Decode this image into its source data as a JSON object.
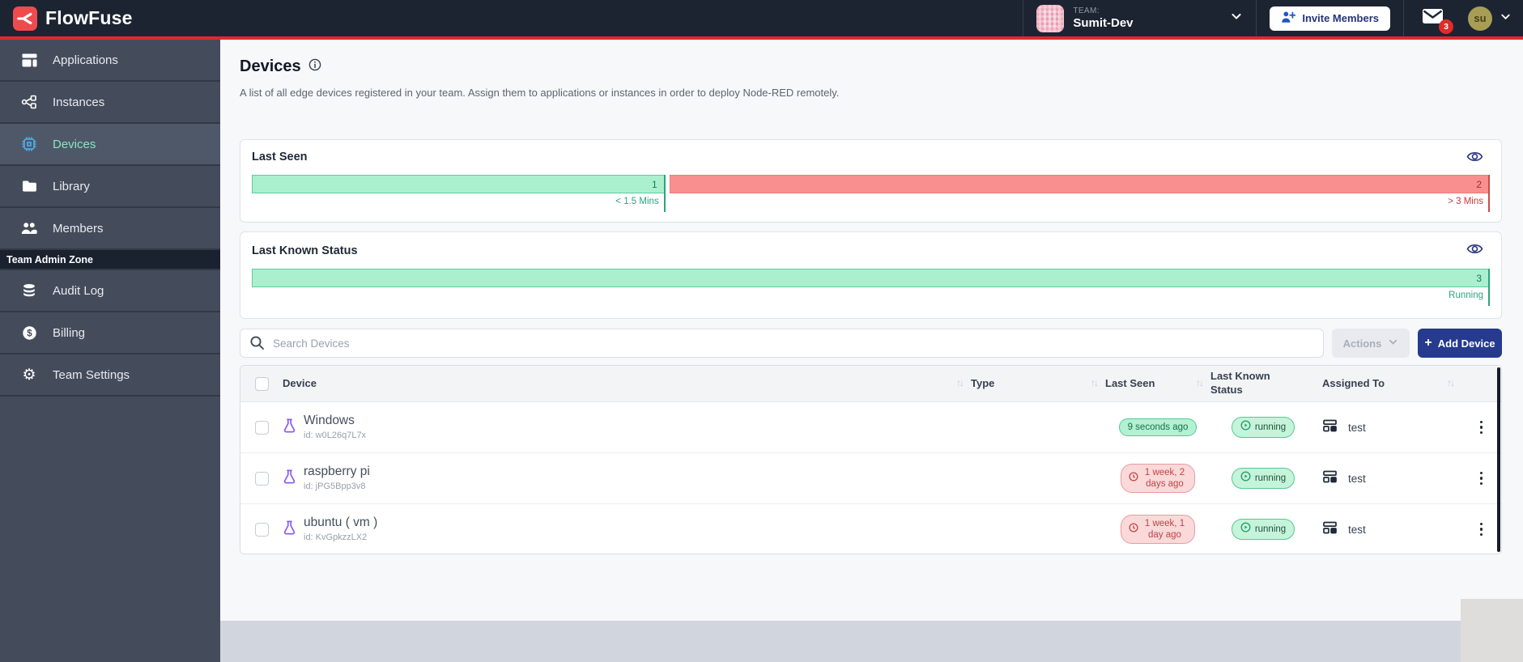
{
  "colors": {
    "accent_red": "#dc2a2e",
    "brand_navy": "#263a8e",
    "status_green_bar": "#aaf0cf",
    "status_red_bar": "#f98f8f",
    "header_bg": "#1c2432",
    "sidebar_bg": "#444c5c"
  },
  "icons": {
    "sort_glyph": "↑↓",
    "gear_glyph": "⚙",
    "plus_glyph": "+"
  },
  "header": {
    "logo_text": "FlowFuse",
    "team_label": "TEAM:",
    "team_name": "Sumit-Dev",
    "invite_members_label": "Invite Members",
    "notification_count": "3",
    "avatar_initials": "su"
  },
  "sidebar": {
    "items": [
      {
        "label": "Applications",
        "icon": "applications-icon"
      },
      {
        "label": "Instances",
        "icon": "instances-icon"
      },
      {
        "label": "Devices",
        "icon": "devices-icon",
        "active": true
      },
      {
        "label": "Library",
        "icon": "library-icon"
      },
      {
        "label": "Members",
        "icon": "members-icon"
      }
    ],
    "admin_zone_label": "Team Admin Zone",
    "admin_items": [
      {
        "label": "Audit Log",
        "icon": "database-icon"
      },
      {
        "label": "Billing",
        "icon": "dollar-icon"
      },
      {
        "label": "Team Settings",
        "icon": "gear-icon"
      }
    ]
  },
  "page": {
    "title": "Devices",
    "description": "A list of all edge devices registered in your team. Assign them to applications or instances in order to deploy Node-RED remotely."
  },
  "charts": {
    "last_seen": {
      "title": "Last Seen",
      "segments": [
        {
          "count": 1,
          "label": "< 1.5 Mins",
          "color": "green"
        },
        {
          "count": 2,
          "label": "> 3 Mins",
          "color": "red"
        }
      ]
    },
    "last_known_status": {
      "title": "Last Known Status",
      "segments": [
        {
          "count": 3,
          "label": "Running",
          "color": "green"
        }
      ]
    }
  },
  "toolbar": {
    "search_placeholder": "Search Devices",
    "actions_label": "Actions",
    "add_device_label": "Add Device"
  },
  "table": {
    "headers": {
      "device": "Device",
      "type": "Type",
      "last_seen": "Last Seen",
      "last_known_status": "Last Known Status",
      "assigned_to": "Assigned To"
    },
    "rows": [
      {
        "name": "Windows",
        "device_id": "id: w0L26q7L7x",
        "last_seen": "9 seconds ago",
        "last_seen_state": "recent",
        "status": "running",
        "assigned_to": "test"
      },
      {
        "name": "raspberry pi",
        "device_id": "id: jPG5Bpp3v8",
        "last_seen": "1 week, 2 days ago",
        "last_seen_state": "stale",
        "status": "running",
        "assigned_to": "test"
      },
      {
        "name": "ubuntu ( vm )",
        "device_id": "id: KvGpkzzLX2",
        "last_seen": "1 week, 1 day ago",
        "last_seen_state": "stale",
        "status": "running",
        "assigned_to": "test"
      }
    ]
  }
}
